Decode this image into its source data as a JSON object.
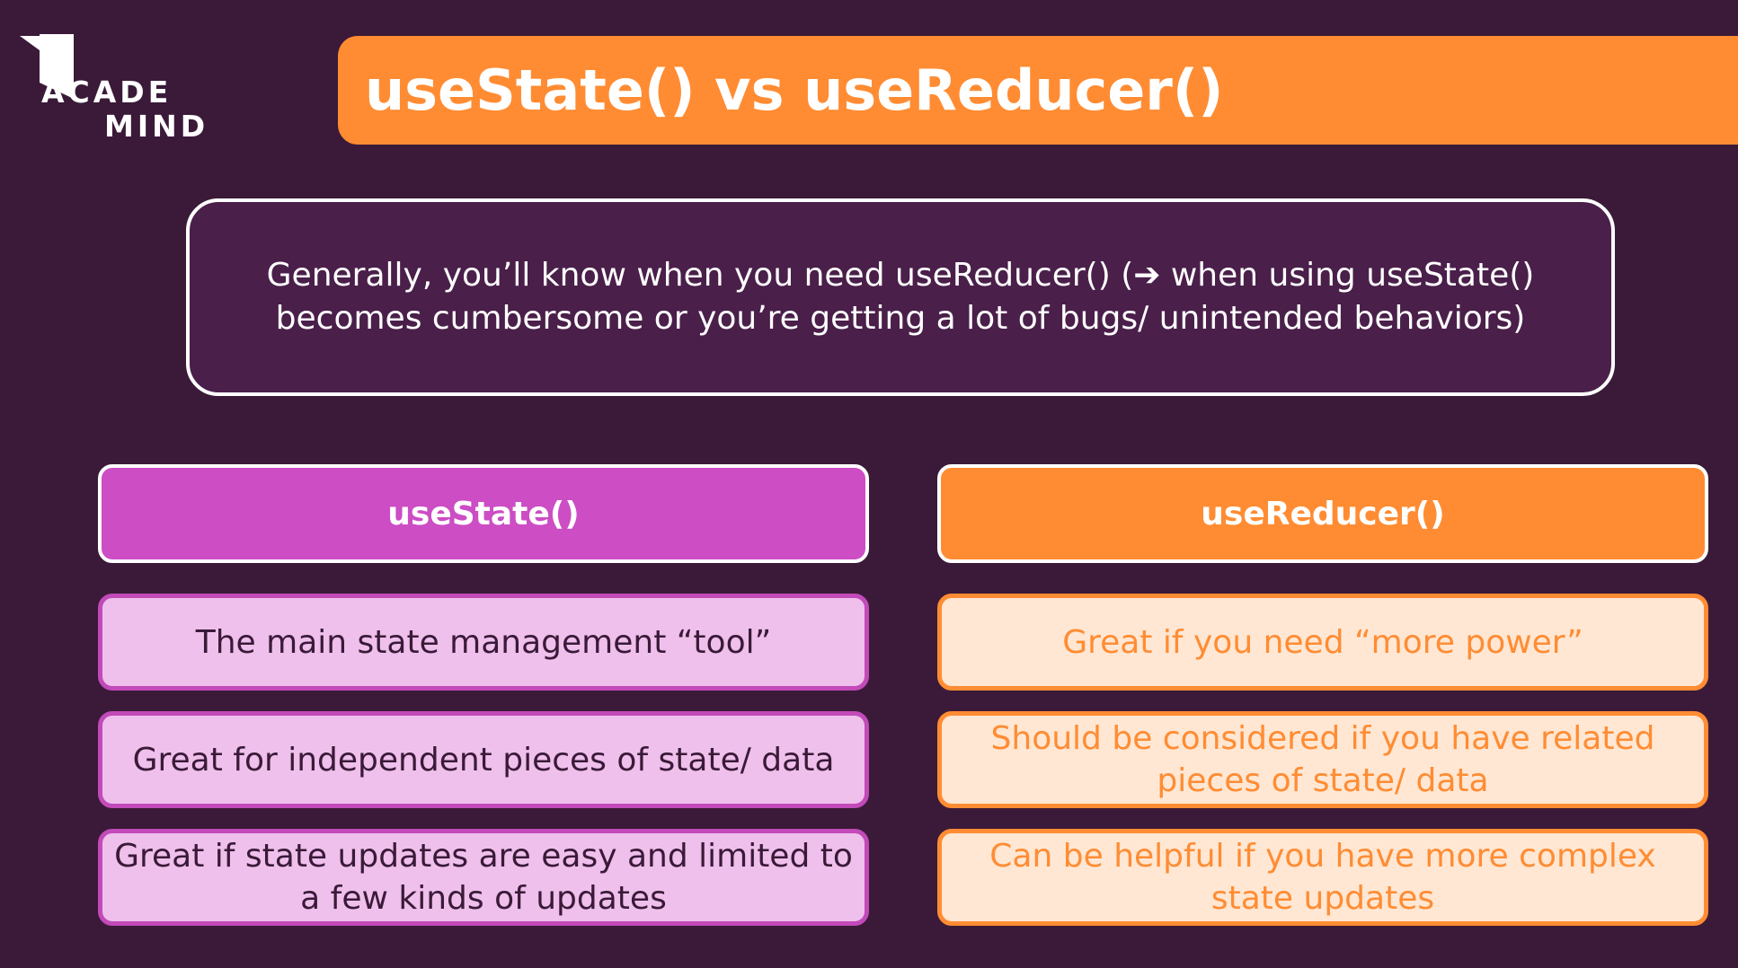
{
  "logo": {
    "line1": "ACADE",
    "line2": "MIND",
    "icon": "bookmark-flag-icon"
  },
  "title": "useState() vs useReducer()",
  "info": {
    "line1": "Generally, you’ll know when you need useReducer() (➔ when using useState()",
    "line2": "becomes cumbersome or you’re getting a lot of bugs/ unintended behaviors)"
  },
  "left": {
    "header": "useState()",
    "items": [
      {
        "line1": "The main state management “tool”",
        "line2": ""
      },
      {
        "line1": "Great for independent pieces of state/ data",
        "line2": ""
      },
      {
        "line1": "Great if state updates are easy and limited to",
        "line2": "a few kinds of updates"
      }
    ]
  },
  "right": {
    "header": "useReducer()",
    "items": [
      {
        "line1": "Great if you need “more power”",
        "line2": ""
      },
      {
        "line1": "Should be considered if you have related",
        "line2": "pieces of state/ data"
      },
      {
        "line1": "Can be helpful if you have more complex",
        "line2": "state updates"
      }
    ]
  },
  "colors": {
    "background": "#3a1a38",
    "orange": "#ff8c33",
    "purple": "#cc4dc4",
    "purple_light": "#efc0ec",
    "orange_light": "#ffe7d3"
  }
}
